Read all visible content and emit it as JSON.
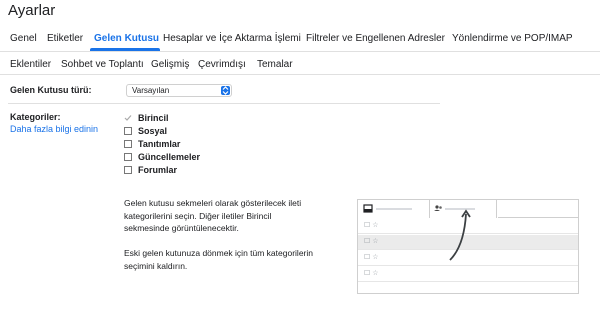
{
  "page": {
    "title": "Ayarlar"
  },
  "tabs_row1": [
    "Genel",
    "Etiketler",
    "Gelen Kutusu",
    "Hesaplar ve İçe Aktarma İşlemi",
    "Filtreler ve Engellenen Adresler",
    "Yönlendirme ve POP/IMAP"
  ],
  "tabs_row2": [
    "Eklentiler",
    "Sohbet ve Toplantı",
    "Gelişmiş",
    "Çevrimdışı",
    "Temalar"
  ],
  "active_tab": "Gelen Kutusu",
  "inbox_type": {
    "label": "Gelen Kutusu türü:",
    "value": "Varsayılan"
  },
  "categories": {
    "label": "Kategoriler:",
    "link": "Daha fazla bilgi edinin",
    "items": [
      {
        "label": "Birincil",
        "checked": true,
        "disabled": true
      },
      {
        "label": "Sosyal",
        "checked": false
      },
      {
        "label": "Tanıtımlar",
        "checked": false
      },
      {
        "label": "Güncellemeler",
        "checked": false
      },
      {
        "label": "Forumlar",
        "checked": false
      }
    ],
    "description_lines": [
      "Gelen kutusu sekmeleri olarak gösterilecek ileti",
      "kategorilerini seçin. Diğer iletiler Birincil",
      "sekmesinde görüntülenecektir."
    ],
    "note_lines": [
      "Eski gelen kutunuza dönmek için tüm kategorilerin",
      "seçimini kaldırın."
    ]
  },
  "colors": {
    "accent": "#1a73e8",
    "text": "#202124",
    "divider": "#e0e0e0"
  },
  "icons": [
    "chevron-updown-icon",
    "checkmark-icon",
    "inbox-icon",
    "people-icon",
    "curved-arrow-icon",
    "star-icon"
  ]
}
